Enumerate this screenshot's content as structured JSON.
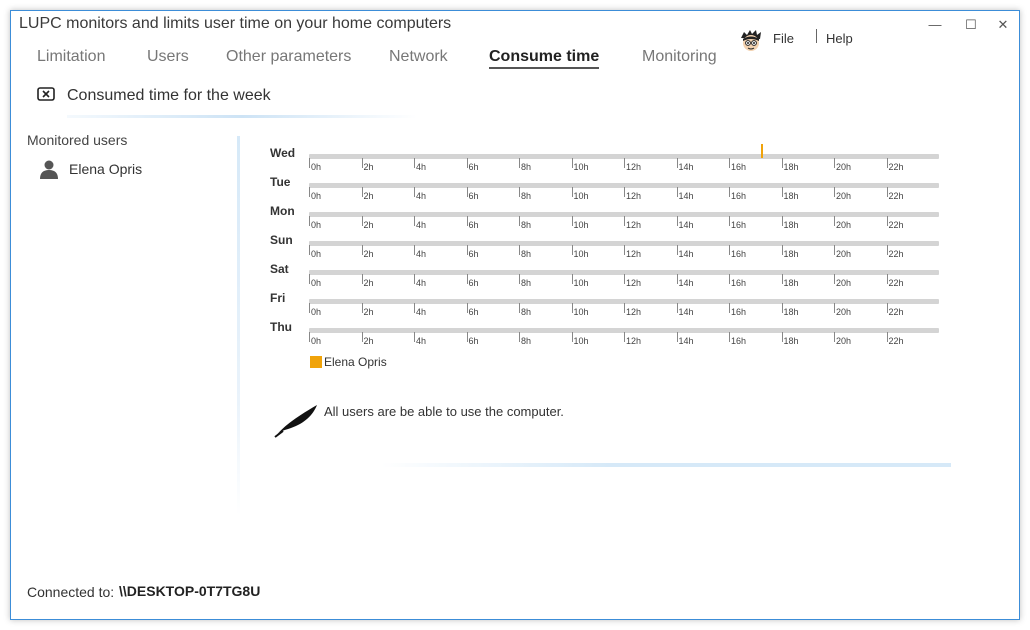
{
  "window": {
    "title": "LUPC monitors and limits user time on your home computers",
    "controls": {
      "minimize": "—",
      "maximize": "☐",
      "close": "✕"
    }
  },
  "menu": {
    "file": "File",
    "help": "Help",
    "avatar_icon": "cartoon-avatar-icon"
  },
  "tabs": [
    {
      "label": "Limitation",
      "active": false
    },
    {
      "label": "Users",
      "active": false
    },
    {
      "label": "Other parameters",
      "active": false
    },
    {
      "label": "Network",
      "active": false
    },
    {
      "label": "Consume time",
      "active": true
    },
    {
      "label": "Monitoring",
      "active": false
    }
  ],
  "section": {
    "title": "Consumed time for the week",
    "icon": "close-box-icon"
  },
  "sidebar": {
    "header": "Monitored users",
    "users": [
      {
        "name": "Elena Opris",
        "icon": "user-icon"
      }
    ]
  },
  "timeline": {
    "days": [
      "Wed",
      "Tue",
      "Mon",
      "Sun",
      "Sat",
      "Fri",
      "Thu"
    ],
    "hour_ticks": [
      "0h",
      "2h",
      "4h",
      "6h",
      "8h",
      "10h",
      "12h",
      "14h",
      "16h",
      "18h",
      "20h",
      "22h"
    ],
    "hour_range": [
      0,
      24
    ],
    "usage": [
      {
        "day": "Wed",
        "user": "Elena Opris",
        "hour": 17.2
      }
    ],
    "usage_color": "#f0a30a"
  },
  "legend": [
    {
      "name": "Elena Opris",
      "color": "#f0a30a"
    }
  ],
  "info": {
    "text": "All users are be able to use the computer.",
    "icon": "feather-icon"
  },
  "footer": {
    "connected_label": "Connected to:",
    "connected_value": "\\\\DESKTOP-0T7TG8U"
  }
}
